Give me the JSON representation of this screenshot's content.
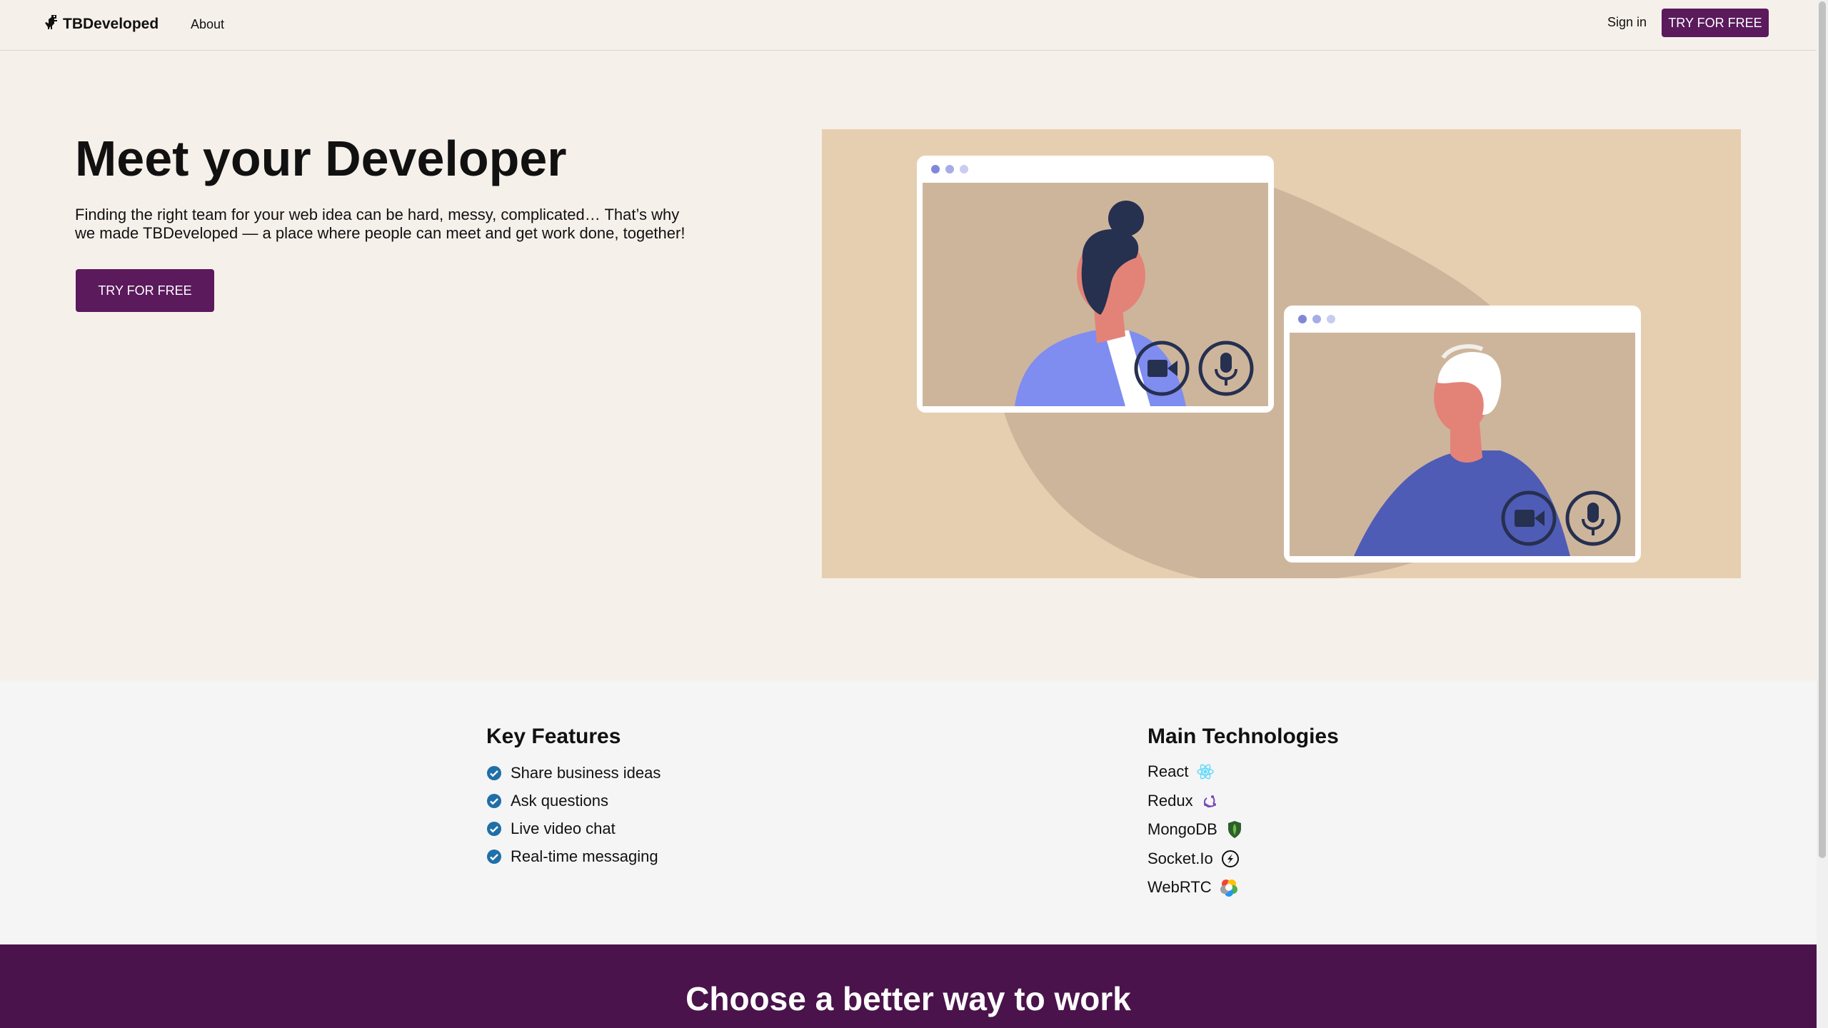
{
  "nav": {
    "brand": "TBDeveloped",
    "about": "About",
    "signin": "Sign in",
    "cta": "TRY FOR FREE"
  },
  "hero": {
    "title": "Meet your Developer",
    "text": "Finding the right team for your web idea can be hard, messy, complicated… That’s why we made TBDeveloped — a place where people can meet and get work done, together!",
    "cta": "TRY FOR FREE"
  },
  "features": {
    "title": "Key Features",
    "items": [
      "Share business ideas",
      "Ask questions",
      "Live video chat",
      "Real-time messaging"
    ]
  },
  "tech": {
    "title": "Main Technologies",
    "items": [
      {
        "label": "React",
        "icon": "react-icon"
      },
      {
        "label": "Redux",
        "icon": "redux-icon"
      },
      {
        "label": "MongoDB",
        "icon": "mongodb-icon"
      },
      {
        "label": "Socket.Io",
        "icon": "socketio-icon"
      },
      {
        "label": "WebRTC",
        "icon": "webrtc-icon"
      }
    ]
  },
  "band": {
    "title": "Choose a better way to work"
  },
  "colors": {
    "brand_purple": "#5a1a5c",
    "band_purple": "#4a134b",
    "page_bg": "#f6f0ea",
    "illustration_bg": "#e6cfb0",
    "check_blue": "#1f6fa8"
  }
}
